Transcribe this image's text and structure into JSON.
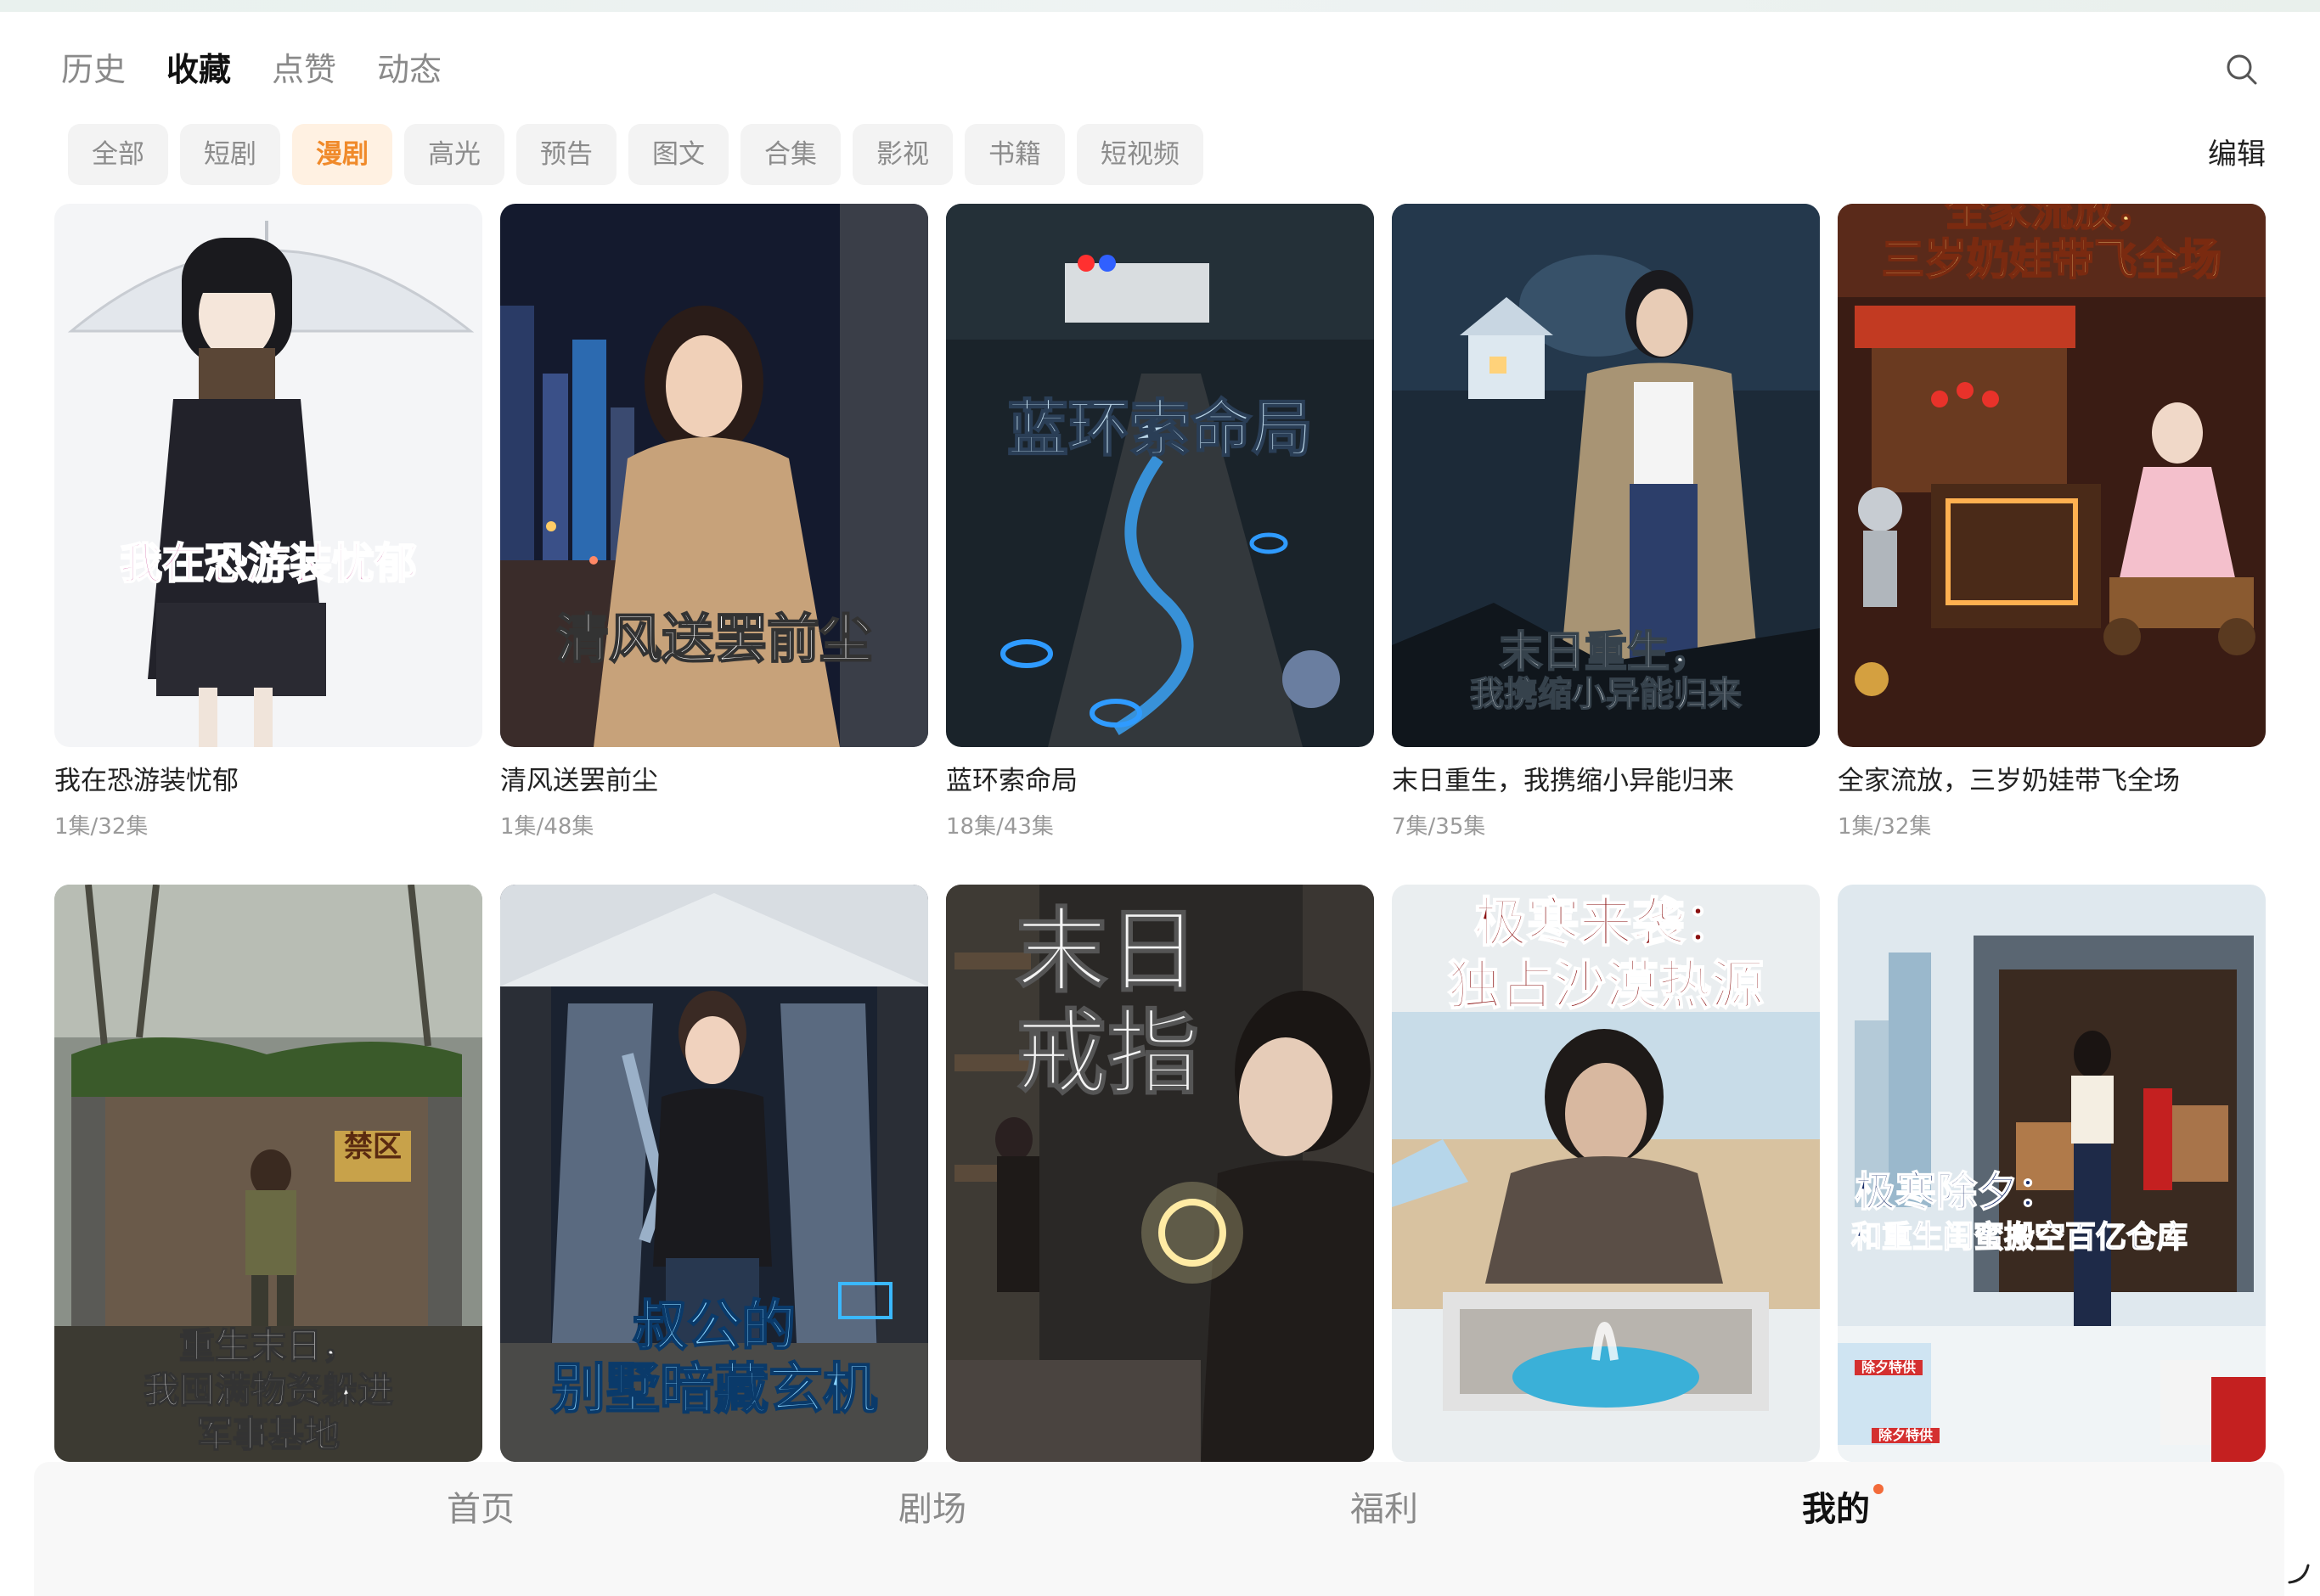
{
  "top_tabs": [
    {
      "label": "历史",
      "active": false
    },
    {
      "label": "收藏",
      "active": true
    },
    {
      "label": "点赞",
      "active": false
    },
    {
      "label": "动态",
      "active": false
    }
  ],
  "search": {
    "icon": "search-icon"
  },
  "filters": [
    {
      "label": "全部",
      "active": false
    },
    {
      "label": "短剧",
      "active": false
    },
    {
      "label": "漫剧",
      "active": true
    },
    {
      "label": "高光",
      "active": false
    },
    {
      "label": "预告",
      "active": false
    },
    {
      "label": "图文",
      "active": false
    },
    {
      "label": "合集",
      "active": false
    },
    {
      "label": "影视",
      "active": false
    },
    {
      "label": "书籍",
      "active": false
    },
    {
      "label": "短视频",
      "active": false
    }
  ],
  "edit_label": "编辑",
  "cards": [
    {
      "title": "我在恐游装忧郁",
      "progress": "1集/32集",
      "cover_text": "我在恐游装忧郁"
    },
    {
      "title": "清风送罢前尘",
      "progress": "1集/48集",
      "cover_text": "清风送罢前尘"
    },
    {
      "title": "蓝环索命局",
      "progress": "18集/43集",
      "cover_text": "蓝环索命局"
    },
    {
      "title": "末日重生，我携缩小异能归来",
      "progress": "7集/35集",
      "cover_line1": "末日重生，",
      "cover_line2": "我携缩小异能归来"
    },
    {
      "title": "全家流放，三岁奶娃带飞全场",
      "progress": "1集/32集",
      "cover_line1": "全家流放，",
      "cover_line2": "三岁奶娃带飞全场"
    },
    {
      "cover_line1": "重生末日，",
      "cover_line2": "我囤满物资躲进",
      "cover_line3": "军事基地",
      "sign": "禁区"
    },
    {
      "cover_line1": "叔公的",
      "cover_line2": "别墅暗藏玄机"
    },
    {
      "cover_line1": "末日",
      "cover_line2": "戒指"
    },
    {
      "cover_line1": "极寒来袭：",
      "cover_line2": "独占沙漠热源"
    },
    {
      "cover_line1": "极寒除夕：",
      "cover_line2": "和重生闺蜜搬空百亿仓库",
      "box1": "除夕特供",
      "box2": "除夕特供"
    }
  ],
  "bottom_nav": [
    {
      "label": "首页",
      "active": false
    },
    {
      "label": "剧场",
      "active": false
    },
    {
      "label": "福利",
      "active": false
    },
    {
      "label": "我的",
      "active": true
    }
  ],
  "colors": {
    "accent": "#f08a2a",
    "chip_active_bg": "#fff1e2",
    "badge_dot": "#f36b3a"
  }
}
